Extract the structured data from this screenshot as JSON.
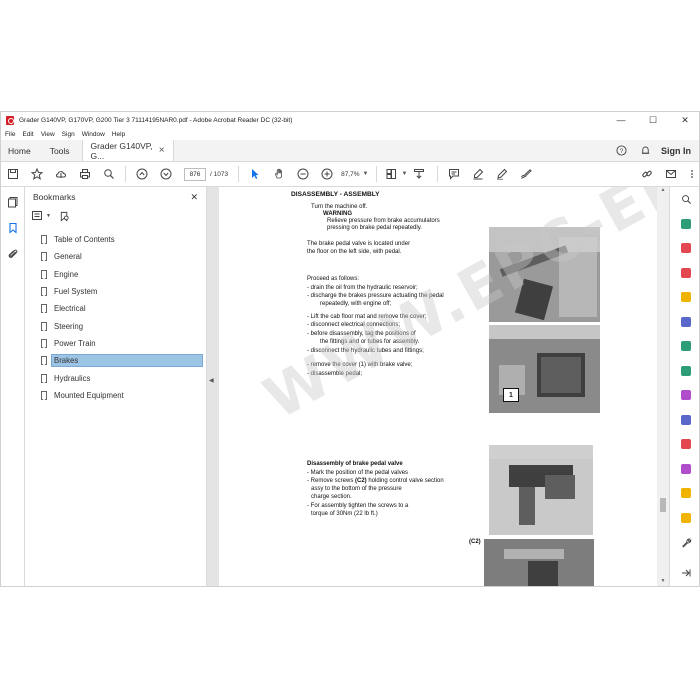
{
  "window": {
    "title": "Grader G140VP, G170VP, G200 Tier 3 71114195NAR0.pdf - Adobe Acrobat Reader DC (32-bit)",
    "minimize": "—",
    "maximize": "☐",
    "close": "✕"
  },
  "menu": [
    "File",
    "Edit",
    "View",
    "Sign",
    "Window",
    "Help"
  ],
  "tabs": {
    "home": "Home",
    "tools": "Tools",
    "doc": "Grader G140VP, G...",
    "doc_close": "×",
    "signin": "Sign In"
  },
  "toolbar": {
    "current_page": "876",
    "total_pages": "/ 1073",
    "zoom": "87,7%"
  },
  "bookmarks": {
    "title": "Bookmarks",
    "close": "✕",
    "items": [
      {
        "label": "Table of Contents"
      },
      {
        "label": "General"
      },
      {
        "label": "Engine"
      },
      {
        "label": "Fuel System"
      },
      {
        "label": "Electrical"
      },
      {
        "label": "Steering"
      },
      {
        "label": "Power Train"
      },
      {
        "label": "Brakes"
      },
      {
        "label": "Hydraulics"
      },
      {
        "label": "Mounted Equipment"
      }
    ]
  },
  "document": {
    "heading": "DISASSEMBLY - ASSEMBLY",
    "lines": {
      "l1": "Turn the machine off.",
      "l2": "WARNING",
      "l3": "Relieve pressure from brake accumulators",
      "l4": "pressing on brake pedal repeatedly.",
      "l5": "The brake pedal valve is located under",
      "l6": "the floor on the left side, with pedal.",
      "l7": "Proceed as follows:",
      "l8": "-    drain the oil from the hydraulic reservoir;",
      "l9": "-    discharge the brakes pressure actuating the pedal",
      "l10": "repeatedly, with engine off;",
      "l11": "-    Lift the cab floor mat and remove the cover;",
      "l12": "-    disconnect electrical connections;",
      "l13": "-    before disassembly, tag the positions of",
      "l14": "the fittings and or tubes for assembly.",
      "l15": "-    disconnect the hydraulic tubes and fittings;",
      "l16": "-    remove the cover (1) with brake valve;",
      "l17": "-    disassemble pedal;",
      "l18": "Disassembly of brake pedal valve",
      "l19": "- Mark the position of the pedal valves",
      "l20_a": "- Remove screws ",
      "l20_b": "(C2)",
      "l20_c": " holding control valve section",
      "l21": "assy to the bottom of the pressure",
      "l22": "charge section.",
      "l23": "- For assembly tighten the screws to a",
      "l24": "torque of 30Nm (22 lb ft.)"
    },
    "callout_1": "1",
    "label_c2": "(C2)",
    "watermark": "WWW.EPC-EPC.COM"
  }
}
